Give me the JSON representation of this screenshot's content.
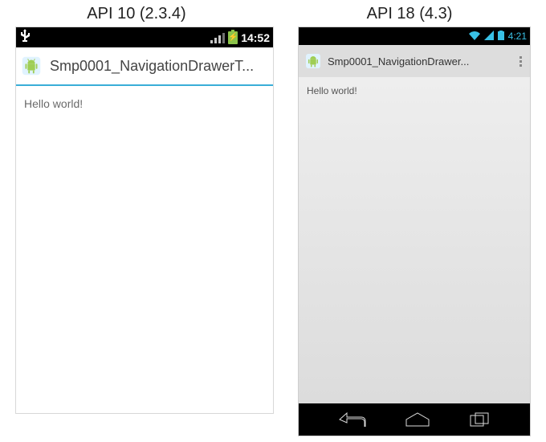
{
  "labels": {
    "left": "API 10 (2.3.4)",
    "right": "API 18 (4.3)"
  },
  "left": {
    "statusbar": {
      "time": "14:52"
    },
    "actionbar": {
      "title": "Smp0001_NavigationDrawerT..."
    },
    "content": {
      "text": "Hello world!"
    }
  },
  "right": {
    "statusbar": {
      "time": "4:21"
    },
    "actionbar": {
      "title": "Smp0001_NavigationDrawer..."
    },
    "content": {
      "text": "Hello world!"
    }
  },
  "icons": {
    "usb": "usb-icon",
    "signal": "signal-icon",
    "battery": "battery-icon",
    "wifi": "wifi-icon",
    "overflow": "overflow-icon",
    "back": "back-icon",
    "home": "home-icon",
    "recent": "recent-icon",
    "app": "android-app-icon"
  }
}
